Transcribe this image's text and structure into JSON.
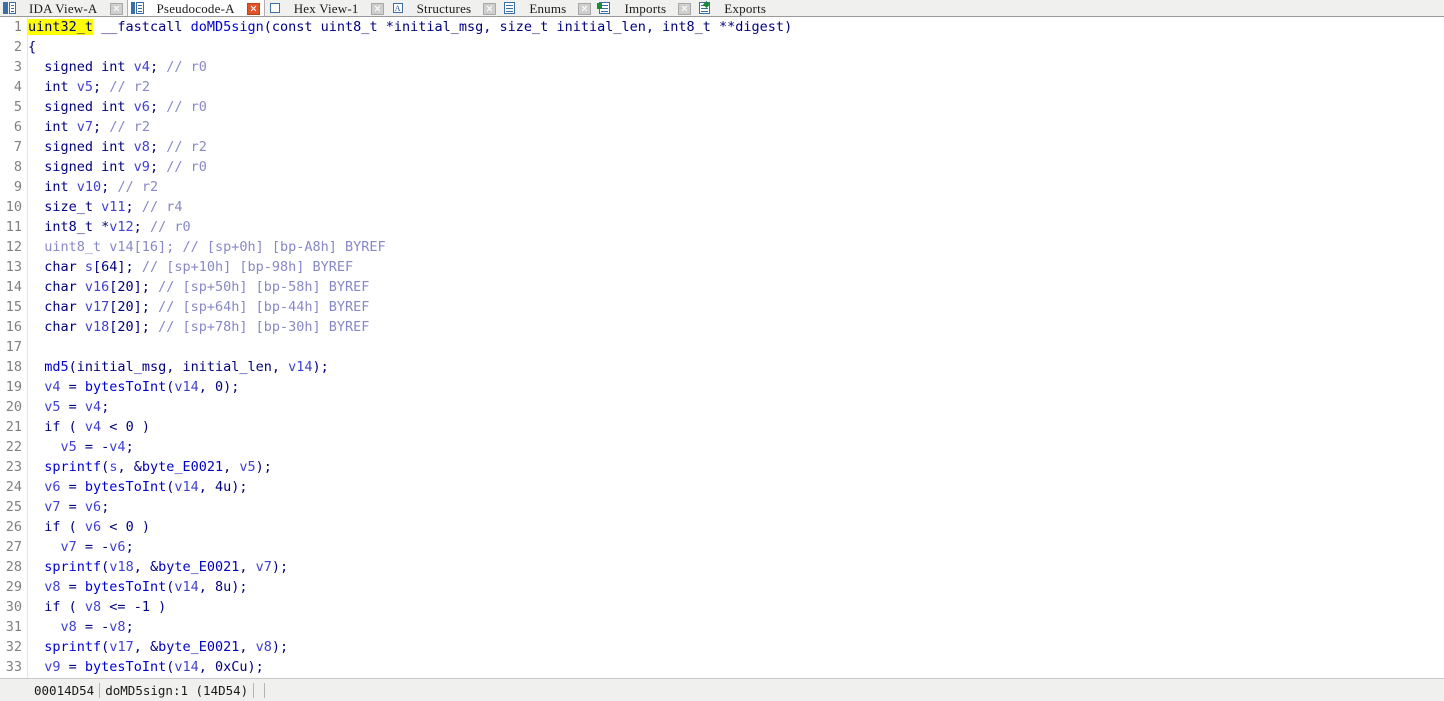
{
  "window": {
    "title": "IDA Pro — Pseudocode-A"
  },
  "tabs": [
    {
      "label": "IDA View-A",
      "icon": "bars-icon",
      "active": false,
      "closable": true,
      "close_style": "gray"
    },
    {
      "label": "Pseudocode-A",
      "icon": "pseudocode-icon",
      "active": true,
      "closable": true,
      "close_style": "red"
    },
    {
      "label": "Hex View-1",
      "icon": "hex-view-icon",
      "active": false,
      "closable": true,
      "close_style": "gray"
    },
    {
      "label": "Structures",
      "icon": "structures-icon",
      "active": false,
      "closable": true,
      "close_style": "gray"
    },
    {
      "label": "Enums",
      "icon": "enums-icon",
      "active": false,
      "closable": true,
      "close_style": "gray"
    },
    {
      "label": "Imports",
      "icon": "imports-icon",
      "active": false,
      "closable": true,
      "close_style": "gray"
    },
    {
      "label": "Exports",
      "icon": "exports-icon",
      "active": false,
      "closable": false,
      "close_style": "gray"
    }
  ],
  "editor": {
    "highlighted_token": "uint32_t",
    "highlight_color": "#ffff00",
    "cursor_line": 1,
    "lines": [
      {
        "n": 1,
        "tokens": [
          {
            "t": "uint32_t",
            "c": "hl"
          },
          {
            "t": " ",
            "c": "plain"
          },
          {
            "t": "__fastcall",
            "c": "key"
          },
          {
            "t": " ",
            "c": "plain"
          },
          {
            "t": "doMD5sign",
            "c": "fn"
          },
          {
            "t": "(",
            "c": "punc"
          },
          {
            "t": "const",
            "c": "key"
          },
          {
            "t": " ",
            "c": "plain"
          },
          {
            "t": "uint8_t",
            "c": "key"
          },
          {
            "t": " *",
            "c": "punc"
          },
          {
            "t": "initial_msg",
            "c": "arg"
          },
          {
            "t": ", ",
            "c": "punc"
          },
          {
            "t": "size_t",
            "c": "key"
          },
          {
            "t": " ",
            "c": "plain"
          },
          {
            "t": "initial_len",
            "c": "arg"
          },
          {
            "t": ", ",
            "c": "punc"
          },
          {
            "t": "int8_t",
            "c": "key"
          },
          {
            "t": " **",
            "c": "punc"
          },
          {
            "t": "digest",
            "c": "arg"
          },
          {
            "t": ")",
            "c": "punc"
          }
        ]
      },
      {
        "n": 2,
        "tokens": [
          {
            "t": "{",
            "c": "punc"
          }
        ]
      },
      {
        "n": 3,
        "tokens": [
          {
            "t": "  signed int ",
            "c": "key"
          },
          {
            "t": "v4",
            "c": "var"
          },
          {
            "t": "; ",
            "c": "punc"
          },
          {
            "t": "// r0",
            "c": "cmt"
          }
        ]
      },
      {
        "n": 4,
        "tokens": [
          {
            "t": "  int ",
            "c": "key"
          },
          {
            "t": "v5",
            "c": "var"
          },
          {
            "t": "; ",
            "c": "punc"
          },
          {
            "t": "// r2",
            "c": "cmt"
          }
        ]
      },
      {
        "n": 5,
        "tokens": [
          {
            "t": "  signed int ",
            "c": "key"
          },
          {
            "t": "v6",
            "c": "var"
          },
          {
            "t": "; ",
            "c": "punc"
          },
          {
            "t": "// r0",
            "c": "cmt"
          }
        ]
      },
      {
        "n": 6,
        "tokens": [
          {
            "t": "  int ",
            "c": "key"
          },
          {
            "t": "v7",
            "c": "var"
          },
          {
            "t": "; ",
            "c": "punc"
          },
          {
            "t": "// r2",
            "c": "cmt"
          }
        ]
      },
      {
        "n": 7,
        "tokens": [
          {
            "t": "  signed int ",
            "c": "key"
          },
          {
            "t": "v8",
            "c": "var"
          },
          {
            "t": "; ",
            "c": "punc"
          },
          {
            "t": "// r2",
            "c": "cmt"
          }
        ]
      },
      {
        "n": 8,
        "tokens": [
          {
            "t": "  signed int ",
            "c": "key"
          },
          {
            "t": "v9",
            "c": "var"
          },
          {
            "t": "; ",
            "c": "punc"
          },
          {
            "t": "// r0",
            "c": "cmt"
          }
        ]
      },
      {
        "n": 9,
        "tokens": [
          {
            "t": "  int ",
            "c": "key"
          },
          {
            "t": "v10",
            "c": "var"
          },
          {
            "t": "; ",
            "c": "punc"
          },
          {
            "t": "// r2",
            "c": "cmt"
          }
        ]
      },
      {
        "n": 10,
        "tokens": [
          {
            "t": "  size_t ",
            "c": "key"
          },
          {
            "t": "v11",
            "c": "var"
          },
          {
            "t": "; ",
            "c": "punc"
          },
          {
            "t": "// r4",
            "c": "cmt"
          }
        ]
      },
      {
        "n": 11,
        "tokens": [
          {
            "t": "  int8_t *",
            "c": "key"
          },
          {
            "t": "v12",
            "c": "var"
          },
          {
            "t": "; ",
            "c": "punc"
          },
          {
            "t": "// r0",
            "c": "cmt"
          }
        ]
      },
      {
        "n": 12,
        "tokens": [
          {
            "t": "  uint8_t ",
            "c": "cmt"
          },
          {
            "t": "v14",
            "c": "cmt"
          },
          {
            "t": "[16]; ",
            "c": "cmt"
          },
          {
            "t": "// [sp+0h] [bp-A8h] BYREF",
            "c": "cmt"
          }
        ]
      },
      {
        "n": 13,
        "tokens": [
          {
            "t": "  char ",
            "c": "key"
          },
          {
            "t": "s",
            "c": "var"
          },
          {
            "t": "[64]; ",
            "c": "punc"
          },
          {
            "t": "// [sp+10h] [bp-98h] BYREF",
            "c": "cmt"
          }
        ]
      },
      {
        "n": 14,
        "tokens": [
          {
            "t": "  char ",
            "c": "key"
          },
          {
            "t": "v16",
            "c": "var"
          },
          {
            "t": "[20]; ",
            "c": "punc"
          },
          {
            "t": "// [sp+50h] [bp-58h] BYREF",
            "c": "cmt"
          }
        ]
      },
      {
        "n": 15,
        "tokens": [
          {
            "t": "  char ",
            "c": "key"
          },
          {
            "t": "v17",
            "c": "var"
          },
          {
            "t": "[20]; ",
            "c": "punc"
          },
          {
            "t": "// [sp+64h] [bp-44h] BYREF",
            "c": "cmt"
          }
        ]
      },
      {
        "n": 16,
        "tokens": [
          {
            "t": "  char ",
            "c": "key"
          },
          {
            "t": "v18",
            "c": "var"
          },
          {
            "t": "[20]; ",
            "c": "punc"
          },
          {
            "t": "// [sp+78h] [bp-30h] BYREF",
            "c": "cmt"
          }
        ]
      },
      {
        "n": 17,
        "tokens": [
          {
            "t": "",
            "c": "plain"
          }
        ]
      },
      {
        "n": 18,
        "tokens": [
          {
            "t": "  ",
            "c": "plain"
          },
          {
            "t": "md5",
            "c": "fn"
          },
          {
            "t": "(",
            "c": "punc"
          },
          {
            "t": "initial_msg",
            "c": "arg"
          },
          {
            "t": ", ",
            "c": "punc"
          },
          {
            "t": "initial_len",
            "c": "arg"
          },
          {
            "t": ", ",
            "c": "punc"
          },
          {
            "t": "v14",
            "c": "var"
          },
          {
            "t": ");",
            "c": "punc"
          }
        ]
      },
      {
        "n": 19,
        "tokens": [
          {
            "t": "  ",
            "c": "plain"
          },
          {
            "t": "v4",
            "c": "var"
          },
          {
            "t": " = ",
            "c": "punc"
          },
          {
            "t": "bytesToInt",
            "c": "fn"
          },
          {
            "t": "(",
            "c": "punc"
          },
          {
            "t": "v14",
            "c": "var"
          },
          {
            "t": ", ",
            "c": "punc"
          },
          {
            "t": "0",
            "c": "num"
          },
          {
            "t": ");",
            "c": "punc"
          }
        ]
      },
      {
        "n": 20,
        "tokens": [
          {
            "t": "  ",
            "c": "plain"
          },
          {
            "t": "v5",
            "c": "var"
          },
          {
            "t": " = ",
            "c": "punc"
          },
          {
            "t": "v4",
            "c": "var"
          },
          {
            "t": ";",
            "c": "punc"
          }
        ]
      },
      {
        "n": 21,
        "tokens": [
          {
            "t": "  if ( ",
            "c": "key"
          },
          {
            "t": "v4",
            "c": "var"
          },
          {
            "t": " < ",
            "c": "punc"
          },
          {
            "t": "0",
            "c": "num"
          },
          {
            "t": " )",
            "c": "punc"
          }
        ]
      },
      {
        "n": 22,
        "tokens": [
          {
            "t": "    ",
            "c": "plain"
          },
          {
            "t": "v5",
            "c": "var"
          },
          {
            "t": " = -",
            "c": "punc"
          },
          {
            "t": "v4",
            "c": "var"
          },
          {
            "t": ";",
            "c": "punc"
          }
        ]
      },
      {
        "n": 23,
        "tokens": [
          {
            "t": "  ",
            "c": "plain"
          },
          {
            "t": "sprintf",
            "c": "fn"
          },
          {
            "t": "(",
            "c": "punc"
          },
          {
            "t": "s",
            "c": "var"
          },
          {
            "t": ", &",
            "c": "punc"
          },
          {
            "t": "byte_E0021",
            "c": "gl"
          },
          {
            "t": ", ",
            "c": "punc"
          },
          {
            "t": "v5",
            "c": "var"
          },
          {
            "t": ");",
            "c": "punc"
          }
        ]
      },
      {
        "n": 24,
        "tokens": [
          {
            "t": "  ",
            "c": "plain"
          },
          {
            "t": "v6",
            "c": "var"
          },
          {
            "t": " = ",
            "c": "punc"
          },
          {
            "t": "bytesToInt",
            "c": "fn"
          },
          {
            "t": "(",
            "c": "punc"
          },
          {
            "t": "v14",
            "c": "var"
          },
          {
            "t": ", ",
            "c": "punc"
          },
          {
            "t": "4u",
            "c": "num"
          },
          {
            "t": ");",
            "c": "punc"
          }
        ]
      },
      {
        "n": 25,
        "tokens": [
          {
            "t": "  ",
            "c": "plain"
          },
          {
            "t": "v7",
            "c": "var"
          },
          {
            "t": " = ",
            "c": "punc"
          },
          {
            "t": "v6",
            "c": "var"
          },
          {
            "t": ";",
            "c": "punc"
          }
        ]
      },
      {
        "n": 26,
        "tokens": [
          {
            "t": "  if ( ",
            "c": "key"
          },
          {
            "t": "v6",
            "c": "var"
          },
          {
            "t": " < ",
            "c": "punc"
          },
          {
            "t": "0",
            "c": "num"
          },
          {
            "t": " )",
            "c": "punc"
          }
        ]
      },
      {
        "n": 27,
        "tokens": [
          {
            "t": "    ",
            "c": "plain"
          },
          {
            "t": "v7",
            "c": "var"
          },
          {
            "t": " = -",
            "c": "punc"
          },
          {
            "t": "v6",
            "c": "var"
          },
          {
            "t": ";",
            "c": "punc"
          }
        ]
      },
      {
        "n": 28,
        "tokens": [
          {
            "t": "  ",
            "c": "plain"
          },
          {
            "t": "sprintf",
            "c": "fn"
          },
          {
            "t": "(",
            "c": "punc"
          },
          {
            "t": "v18",
            "c": "var"
          },
          {
            "t": ", &",
            "c": "punc"
          },
          {
            "t": "byte_E0021",
            "c": "gl"
          },
          {
            "t": ", ",
            "c": "punc"
          },
          {
            "t": "v7",
            "c": "var"
          },
          {
            "t": ");",
            "c": "punc"
          }
        ]
      },
      {
        "n": 29,
        "tokens": [
          {
            "t": "  ",
            "c": "plain"
          },
          {
            "t": "v8",
            "c": "var"
          },
          {
            "t": " = ",
            "c": "punc"
          },
          {
            "t": "bytesToInt",
            "c": "fn"
          },
          {
            "t": "(",
            "c": "punc"
          },
          {
            "t": "v14",
            "c": "var"
          },
          {
            "t": ", ",
            "c": "punc"
          },
          {
            "t": "8u",
            "c": "num"
          },
          {
            "t": ");",
            "c": "punc"
          }
        ]
      },
      {
        "n": 30,
        "tokens": [
          {
            "t": "  if ( ",
            "c": "key"
          },
          {
            "t": "v8",
            "c": "var"
          },
          {
            "t": " <= ",
            "c": "punc"
          },
          {
            "t": "-1",
            "c": "num"
          },
          {
            "t": " )",
            "c": "punc"
          }
        ]
      },
      {
        "n": 31,
        "tokens": [
          {
            "t": "    ",
            "c": "plain"
          },
          {
            "t": "v8",
            "c": "var"
          },
          {
            "t": " = -",
            "c": "punc"
          },
          {
            "t": "v8",
            "c": "var"
          },
          {
            "t": ";",
            "c": "punc"
          }
        ]
      },
      {
        "n": 32,
        "tokens": [
          {
            "t": "  ",
            "c": "plain"
          },
          {
            "t": "sprintf",
            "c": "fn"
          },
          {
            "t": "(",
            "c": "punc"
          },
          {
            "t": "v17",
            "c": "var"
          },
          {
            "t": ", &",
            "c": "punc"
          },
          {
            "t": "byte_E0021",
            "c": "gl"
          },
          {
            "t": ", ",
            "c": "punc"
          },
          {
            "t": "v8",
            "c": "var"
          },
          {
            "t": ");",
            "c": "punc"
          }
        ]
      },
      {
        "n": 33,
        "tokens": [
          {
            "t": "  ",
            "c": "plain"
          },
          {
            "t": "v9",
            "c": "var"
          },
          {
            "t": " = ",
            "c": "punc"
          },
          {
            "t": "bytesToInt",
            "c": "fn"
          },
          {
            "t": "(",
            "c": "punc"
          },
          {
            "t": "v14",
            "c": "var"
          },
          {
            "t": ", ",
            "c": "punc"
          },
          {
            "t": "0xCu",
            "c": "num"
          },
          {
            "t": ");",
            "c": "punc"
          }
        ]
      }
    ]
  },
  "statusbar": {
    "address": "00014D54",
    "location": "doMD5sign:1 (14D54)",
    "extra": ""
  }
}
